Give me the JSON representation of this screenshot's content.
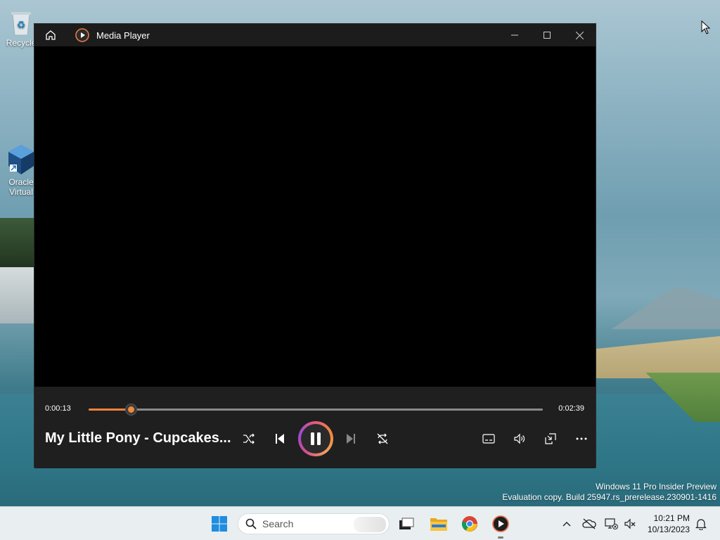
{
  "desktop": {
    "icons": [
      {
        "label": "Recycle"
      },
      {
        "label": "Oracle Virtual"
      }
    ],
    "watermark_line1": "Windows 11 Pro Insider Preview",
    "watermark_line2": "Evaluation copy. Build 25947.rs_prerelease.230901-1416"
  },
  "window": {
    "title": "Media Player",
    "icons": {
      "home": "home-icon",
      "app": "media-player-icon",
      "minimize": "minimize-icon",
      "maximize": "maximize-icon",
      "close": "close-icon"
    }
  },
  "player": {
    "current_time": "0:00:13",
    "duration": "0:02:39",
    "progress_fraction": 0.0925,
    "now_playing": "My Little Pony - Cupcakes...",
    "state": "playing",
    "accent_color": "#f1813a",
    "buttons": [
      "shuffle",
      "previous",
      "pause",
      "next",
      "repeat",
      "captions",
      "volume",
      "mini-player",
      "more"
    ]
  },
  "taskbar": {
    "search_placeholder": "Search",
    "apps": [
      "start",
      "search",
      "task-view",
      "file-explorer",
      "chrome",
      "media-player"
    ],
    "clock_time": "10:21 PM",
    "clock_date": "10/13/2023"
  }
}
